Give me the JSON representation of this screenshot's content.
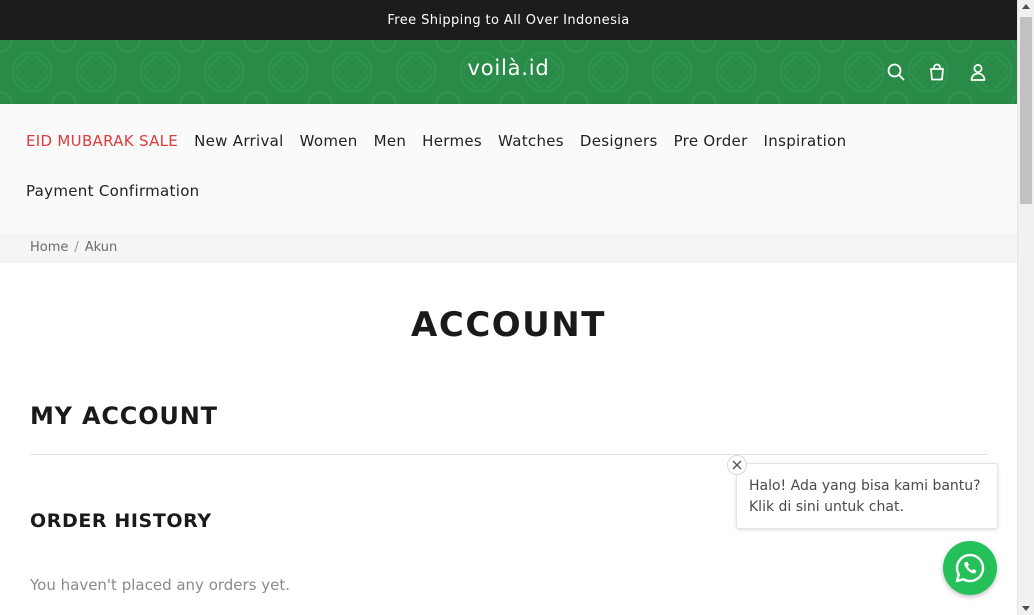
{
  "announcement": {
    "text": "Free Shipping to All Over Indonesia"
  },
  "header": {
    "logo": "voilà.id",
    "background_color": "#2a8a48",
    "icons": [
      "search-icon",
      "cart-icon",
      "user-icon"
    ]
  },
  "nav": {
    "sale_color": "#e03a3a",
    "row1": [
      {
        "label": "EID MUBARAK SALE"
      },
      {
        "label": "New Arrival"
      },
      {
        "label": "Women"
      },
      {
        "label": "Men"
      },
      {
        "label": "Hermes"
      },
      {
        "label": "Watches"
      },
      {
        "label": "Designers"
      },
      {
        "label": "Pre Order"
      },
      {
        "label": "Inspiration"
      }
    ],
    "row2": [
      {
        "label": "Payment Confirmation"
      }
    ]
  },
  "breadcrumb": {
    "home": "Home",
    "separator": "/",
    "current": "Akun"
  },
  "main": {
    "title": "ACCOUNT",
    "my_account": "MY ACCOUNT",
    "order_history": "ORDER HISTORY",
    "empty_orders": "You haven't placed any orders yet."
  },
  "chat": {
    "line1": "Halo! Ada yang bisa kami bantu?",
    "line2": "Klik di sini untuk chat.",
    "button_color": "#25c05a"
  }
}
